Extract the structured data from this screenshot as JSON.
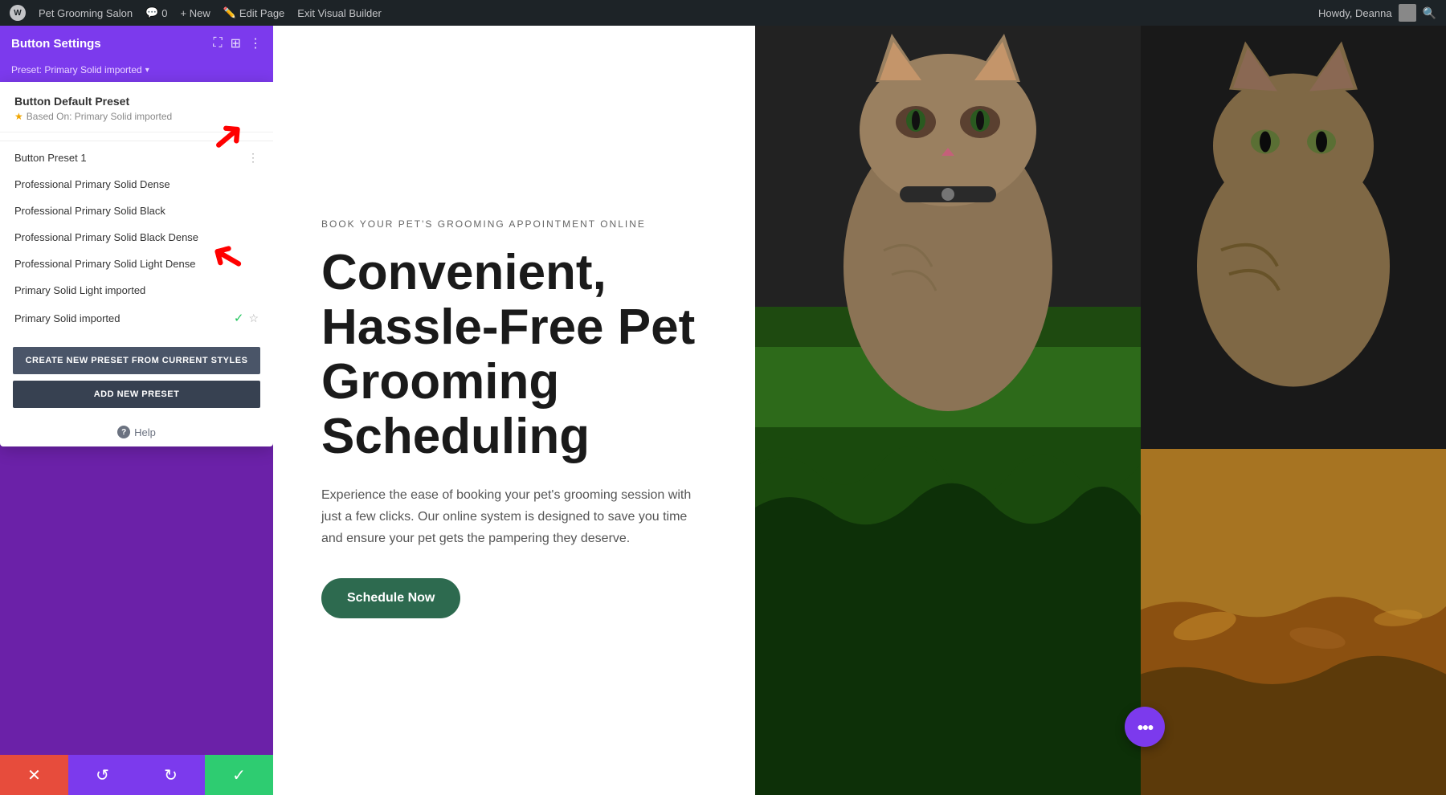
{
  "admin_bar": {
    "wp_logo": "W",
    "site_name": "Pet Grooming Salon",
    "comments_count": "0",
    "new_label": "+ New",
    "edit_page_label": "Edit Page",
    "exit_builder_label": "Exit Visual Builder",
    "user_greeting": "Howdy, Deanna"
  },
  "settings_panel": {
    "title": "Button Settings",
    "preset_label": "Preset: Primary Solid imported",
    "preset_arrow": "▾",
    "icons": {
      "screen": "⛶",
      "columns": "⊞",
      "more": "⋮"
    }
  },
  "preset_dropdown": {
    "default_preset": {
      "title": "Button Default Preset",
      "subtitle": "Based On: Primary Solid imported",
      "star": "★"
    },
    "presets": [
      {
        "label": "Button Preset 1",
        "has_dots": true,
        "checked": false,
        "starred": false
      },
      {
        "label": "Professional Primary Solid Dense",
        "has_dots": false,
        "checked": false,
        "starred": false
      },
      {
        "label": "Professional Primary Solid Black",
        "has_dots": false,
        "checked": false,
        "starred": false
      },
      {
        "label": "Professional Primary Solid Black Dense",
        "has_dots": false,
        "checked": false,
        "starred": false
      },
      {
        "label": "Professional Primary Solid Light Dense",
        "has_dots": false,
        "checked": false,
        "starred": false
      },
      {
        "label": "Primary Solid Light imported",
        "has_dots": false,
        "checked": false,
        "starred": false
      },
      {
        "label": "Primary Solid imported",
        "has_dots": false,
        "checked": true,
        "starred": true
      }
    ],
    "create_btn_label": "CREATE NEW PRESET FROM CURRENT STYLES",
    "add_btn_label": "ADD NEW PRESET",
    "help_label": "Help"
  },
  "bottom_toolbar": {
    "close_icon": "✕",
    "undo_icon": "↺",
    "redo_icon": "↻",
    "save_icon": "✓"
  },
  "hero": {
    "tagline": "BOOK YOUR PET'S GROOMING APPOINTMENT ONLINE",
    "title": "Convenient, Hassle-Free Pet Grooming Scheduling",
    "description": "Experience the ease of booking your pet's grooming session with just a few clicks. Our online system is designed to save you time and ensure your pet gets the pampering they deserve.",
    "cta_button": "Schedule Now"
  },
  "fab": {
    "icon": "•••"
  }
}
